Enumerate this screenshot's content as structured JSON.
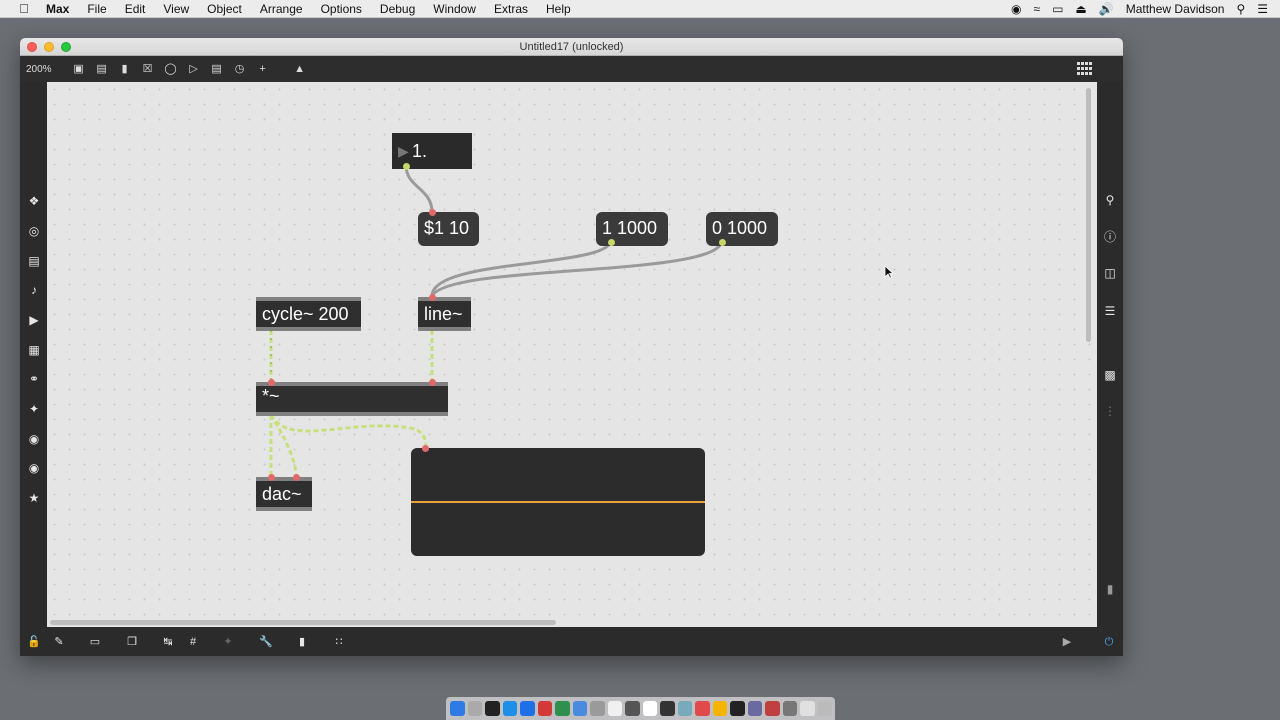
{
  "menubar": {
    "app_name": "Max",
    "items": [
      "File",
      "Edit",
      "View",
      "Object",
      "Arrange",
      "Options",
      "Debug",
      "Window",
      "Extras",
      "Help"
    ],
    "user": "Matthew Davidson"
  },
  "window": {
    "title": "Untitled17 (unlocked)",
    "zoom": "200%"
  },
  "patch": {
    "number_box": "1.",
    "messages": [
      "$1 10",
      "1 1000",
      "0 1000"
    ],
    "objects": [
      "cycle~ 200",
      "line~",
      "*~",
      "dac~"
    ]
  },
  "colors": {
    "signal_wire": "#c8e07a",
    "scope_trace": "#e8a43a",
    "inlet": "#c8d66a",
    "outlet_red": "#e06a6a"
  },
  "dock": {
    "colors": [
      "#2e7be5",
      "#aaaaaa",
      "#222222",
      "#1d8fe8",
      "#1f6fe6",
      "#d23a3a",
      "#2f8f4f",
      "#4a8be0",
      "#9a9a9a",
      "#f0f0f0",
      "#555555",
      "#ffffff",
      "#333333",
      "#7ab",
      "#e04a4a",
      "#f4b400",
      "#222",
      "#6a6aa0",
      "#c04040",
      "#777",
      "#e0e0e0",
      "#bbbbbb"
    ]
  }
}
